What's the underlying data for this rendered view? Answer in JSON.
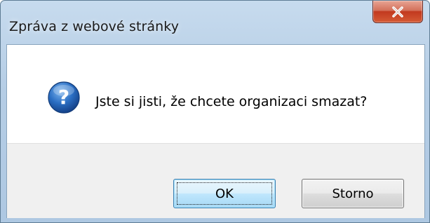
{
  "dialog": {
    "title": "Zpráva z webové stránky",
    "close_icon": "close-icon",
    "message": "Jste si jisti, že chcete organizaci smazat?",
    "message_icon": "question-icon",
    "buttons": {
      "ok_label": "OK",
      "cancel_label": "Storno"
    }
  },
  "colors": {
    "frame": "#b5cde5",
    "close_button": "#c2391f",
    "icon_blue": "#2b6fc4",
    "button_area": "#f0f0f0"
  }
}
